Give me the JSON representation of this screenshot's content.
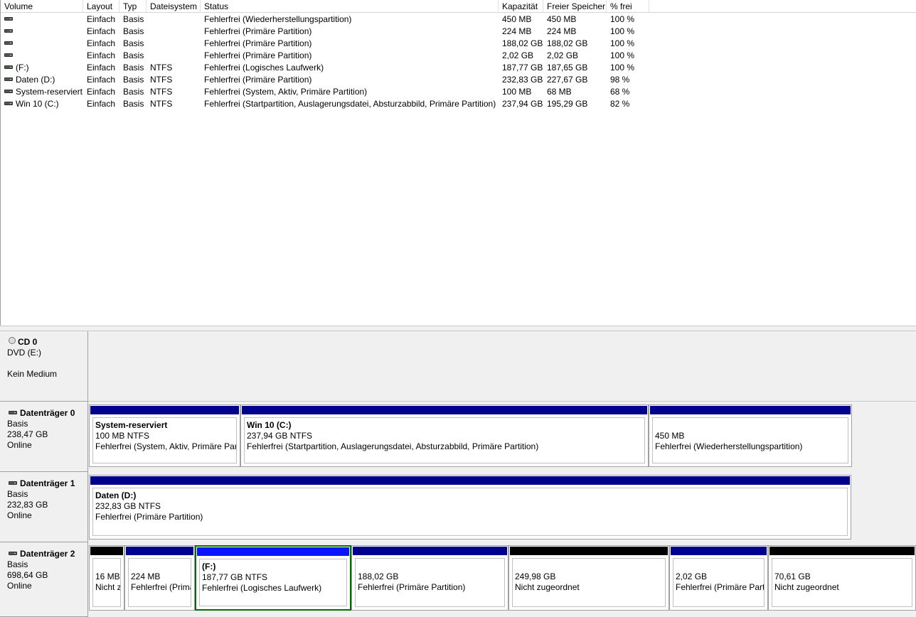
{
  "volume_list": {
    "columns": [
      "Volume",
      "Layout",
      "Typ",
      "Dateisystem",
      "Status",
      "Kapazität",
      "Freier Speicher",
      "% frei"
    ],
    "rows": [
      {
        "volume": "",
        "layout": "Einfach",
        "typ": "Basis",
        "fs": "",
        "status": "Fehlerfrei (Wiederherstellungspartition)",
        "capacity": "450 MB",
        "free": "450 MB",
        "pct": "100 %"
      },
      {
        "volume": "",
        "layout": "Einfach",
        "typ": "Basis",
        "fs": "",
        "status": "Fehlerfrei (Primäre Partition)",
        "capacity": "224 MB",
        "free": "224 MB",
        "pct": "100 %"
      },
      {
        "volume": "",
        "layout": "Einfach",
        "typ": "Basis",
        "fs": "",
        "status": "Fehlerfrei (Primäre Partition)",
        "capacity": "188,02 GB",
        "free": "188,02 GB",
        "pct": "100 %"
      },
      {
        "volume": "",
        "layout": "Einfach",
        "typ": "Basis",
        "fs": "",
        "status": "Fehlerfrei (Primäre Partition)",
        "capacity": "2,02 GB",
        "free": "2,02 GB",
        "pct": "100 %"
      },
      {
        "volume": "(F:)",
        "layout": "Einfach",
        "typ": "Basis",
        "fs": "NTFS",
        "status": "Fehlerfrei (Logisches Laufwerk)",
        "capacity": "187,77 GB",
        "free": "187,65 GB",
        "pct": "100 %"
      },
      {
        "volume": "Daten (D:)",
        "layout": "Einfach",
        "typ": "Basis",
        "fs": "NTFS",
        "status": "Fehlerfrei (Primäre Partition)",
        "capacity": "232,83 GB",
        "free": "227,67 GB",
        "pct": "98 %"
      },
      {
        "volume": "System-reserviert",
        "layout": "Einfach",
        "typ": "Basis",
        "fs": "NTFS",
        "status": "Fehlerfrei (System, Aktiv, Primäre Partition)",
        "capacity": "100 MB",
        "free": "68 MB",
        "pct": "68 %"
      },
      {
        "volume": "Win 10 (C:)",
        "layout": "Einfach",
        "typ": "Basis",
        "fs": "NTFS",
        "status": "Fehlerfrei (Startpartition, Auslagerungsdatei, Absturzabbild, Primäre Partition)",
        "capacity": "237,94 GB",
        "free": "195,29 GB",
        "pct": "82 %"
      }
    ]
  },
  "disks": [
    {
      "title": "CD 0",
      "lines": [
        "DVD (E:)",
        "",
        "Kein Medium"
      ],
      "icon": "cd-icon",
      "partitions": []
    },
    {
      "title": "Datenträger 0",
      "lines": [
        "Basis",
        "238,47 GB",
        "Online"
      ],
      "icon": "drive-icon",
      "partitions": [
        {
          "name": "System-reserviert",
          "size": "100 MB NTFS",
          "status": "Fehlerfrei (System, Aktiv, Primäre Partition)",
          "bar": "navy"
        },
        {
          "name": "Win 10  (C:)",
          "size": "237,94 GB NTFS",
          "status": "Fehlerfrei (Startpartition, Auslagerungsdatei, Absturzabbild, Primäre Partition)",
          "bar": "navy"
        },
        {
          "name": "",
          "size": "450 MB",
          "status": "Fehlerfrei (Wiederherstellungspartition)",
          "bar": "navy"
        }
      ]
    },
    {
      "title": "Datenträger 1",
      "lines": [
        "Basis",
        "232,83 GB",
        "Online"
      ],
      "icon": "drive-icon",
      "partitions": [
        {
          "name": "Daten  (D:)",
          "size": "232,83 GB NTFS",
          "status": "Fehlerfrei (Primäre Partition)",
          "bar": "navy"
        }
      ]
    },
    {
      "title": "Datenträger 2",
      "lines": [
        "Basis",
        "698,64 GB",
        "Online"
      ],
      "icon": "drive-icon",
      "partitions": [
        {
          "name": "",
          "size": "16 MB",
          "status": "Nicht zugeordnet",
          "bar": "black"
        },
        {
          "name": "",
          "size": "224 MB",
          "status": "Fehlerfrei (Primäre Partition)",
          "bar": "navy"
        },
        {
          "name": "(F:)",
          "size": "187,77 GB NTFS",
          "status": "Fehlerfrei (Logisches Laufwerk)",
          "bar": "blue",
          "selected": true
        },
        {
          "name": "",
          "size": "188,02 GB",
          "status": "Fehlerfrei (Primäre Partition)",
          "bar": "navy"
        },
        {
          "name": "",
          "size": "249,98 GB",
          "status": "Nicht zugeordnet",
          "bar": "black"
        },
        {
          "name": "",
          "size": "2,02 GB",
          "status": "Fehlerfrei (Primäre Partition)",
          "bar": "navy"
        },
        {
          "name": "",
          "size": "70,61 GB",
          "status": "Nicht zugeordnet",
          "bar": "black"
        }
      ]
    }
  ],
  "colors": {
    "primary_bar": "#00008b",
    "unallocated_bar": "#000000",
    "logical_bar": "#0a14ff",
    "selection": "#006e00"
  }
}
